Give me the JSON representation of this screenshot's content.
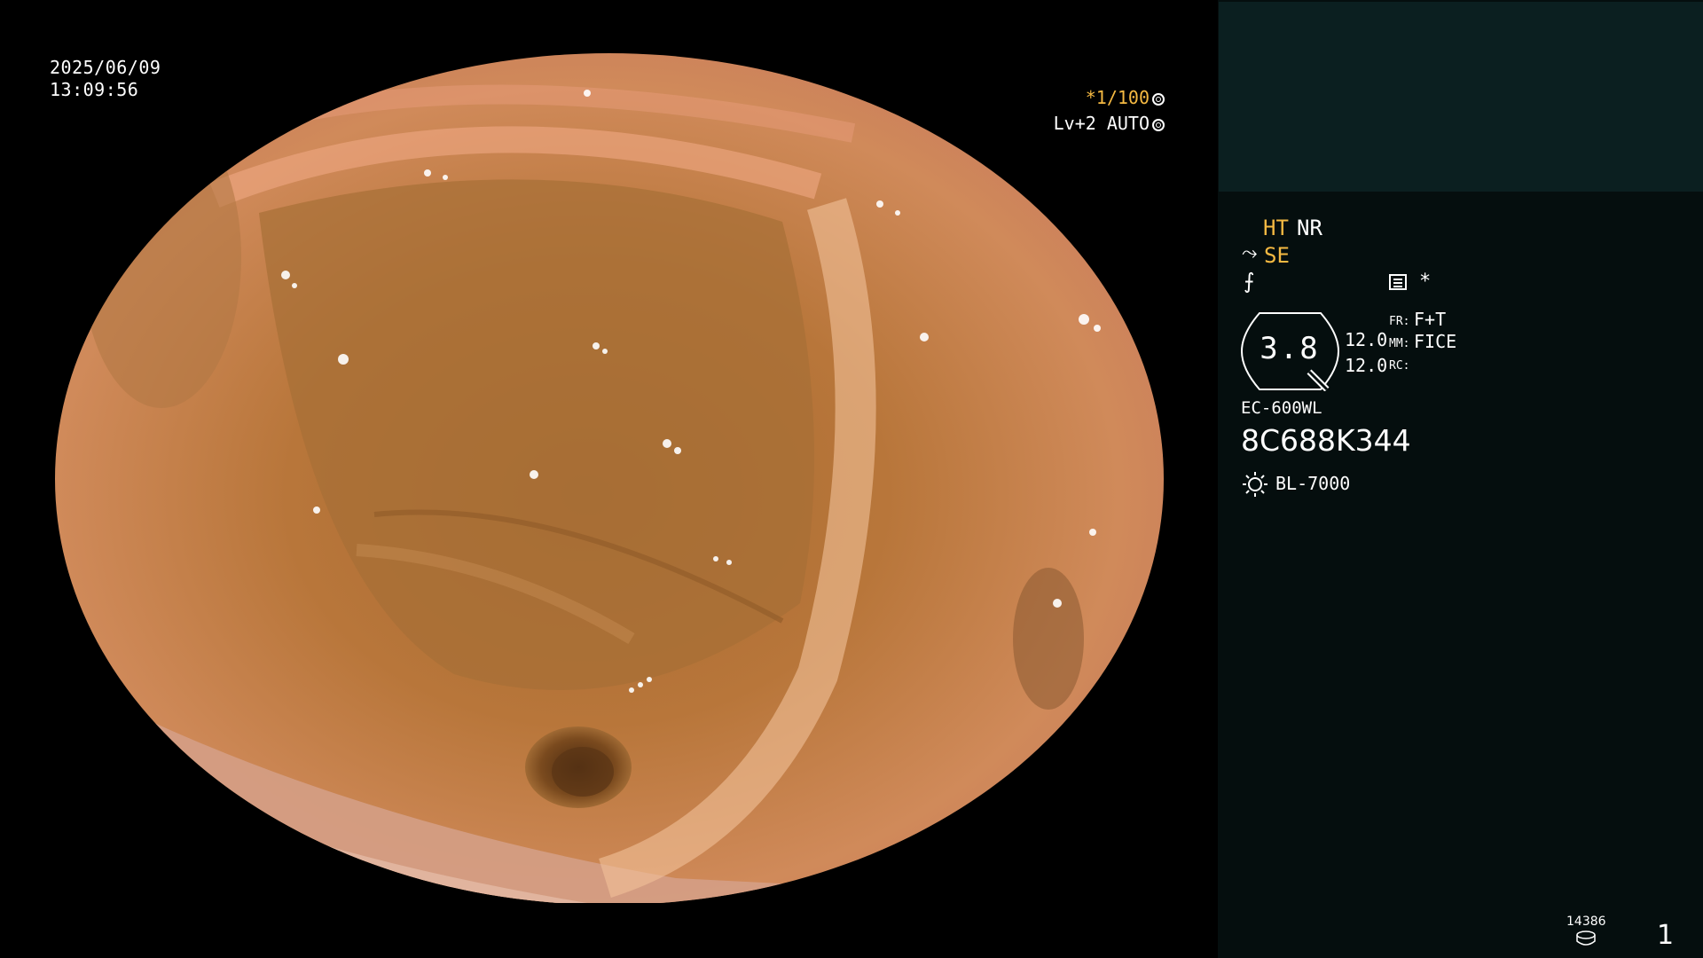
{
  "viewer": {
    "date": "2025/06/09",
    "time": "13:09:56",
    "shutter": "*1/100",
    "shutter_icon": "aperture-icon",
    "level": "Lv+2 AUTO",
    "level_icon": "iris-icon",
    "image": "endoscopic view of intestinal lumen with mucosal folds"
  },
  "panel": {
    "ht": "HT",
    "nr": "NR",
    "se": "SE",
    "icons": [
      "curve-icon",
      "flash-icon",
      "menu-icon",
      "sun-icon",
      "disk-icon"
    ],
    "star": "*",
    "zoom": "3.8",
    "val1": "12.0",
    "val2": "12.0",
    "fr_label": "FR:",
    "fr_value": "F+T",
    "mm_label": "MM:",
    "mm_value": "FICE",
    "rc_label": "RC:",
    "model": "EC-600WL",
    "serial": "8C688K344",
    "lamp": "BL-7000",
    "counter": "14386",
    "page": "1"
  },
  "colors": {
    "accent": "#f5b942",
    "panel_bg": "#050e0e",
    "thumb_bg": "#0b1f20"
  }
}
